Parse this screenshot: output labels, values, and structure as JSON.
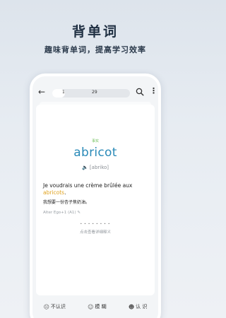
{
  "promo": {
    "title": "背单词",
    "subtitle": "趣味背单词，提高学习效率"
  },
  "topbar": {
    "back_icon": "arrow-left-icon",
    "progress_current": "1",
    "progress_total": "29",
    "progress_fraction": 0.034,
    "search_icon": "search-icon",
    "more_icon": "vertical-ellipsis-icon"
  },
  "card": {
    "tag": "事实",
    "word": "abricot",
    "phonetic": "[abriko]",
    "sentence_before": "Je voudrais une crème brûlée aux ",
    "sentence_highlight": "abricots",
    "sentence_after": ".",
    "translation": "我想要一份杏子焦奶油。",
    "source": "Alter Ego+1 (A1)",
    "dots": "• • • • • • • •",
    "hint": "点击查看详细释义"
  },
  "actions": {
    "unknown": "不认识",
    "vague": "模 糊",
    "known": "认 识"
  },
  "colors": {
    "word": "#2a8ab8",
    "highlight": "#e0a21e",
    "tag": "#6fbf5a"
  }
}
